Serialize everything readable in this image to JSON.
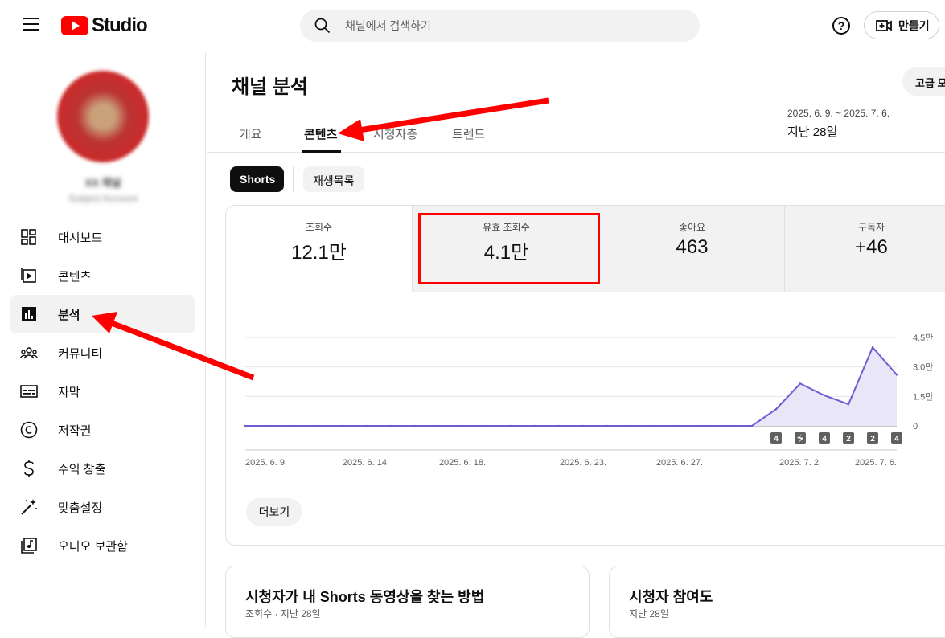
{
  "header": {
    "logo_text": "Studio",
    "search_placeholder": "채널에서 검색하기",
    "create_label": "만들기",
    "help_glyph": "?"
  },
  "sidebar": {
    "channel_name": "XX 채널",
    "channel_sub": "Subject Account",
    "items": [
      {
        "label": "대시보드",
        "icon": "dashboard-icon"
      },
      {
        "label": "콘텐츠",
        "icon": "content-icon"
      },
      {
        "label": "분석",
        "icon": "analytics-icon",
        "active": true
      },
      {
        "label": "커뮤니티",
        "icon": "community-icon"
      },
      {
        "label": "자막",
        "icon": "subtitles-icon"
      },
      {
        "label": "저작권",
        "icon": "copyright-icon"
      },
      {
        "label": "수익 창출",
        "icon": "dollar-icon"
      },
      {
        "label": "맞춤설정",
        "icon": "magic-wand-icon"
      },
      {
        "label": "오디오 보관함",
        "icon": "audio-library-icon"
      }
    ]
  },
  "main": {
    "title": "채널 분석",
    "advanced_label": "고급 모드",
    "tabs": [
      {
        "label": "개요"
      },
      {
        "label": "콘텐츠",
        "active": true
      },
      {
        "label": "시청자층"
      },
      {
        "label": "트렌드"
      }
    ],
    "date_range": "2025. 6. 9. ~ 2025. 7. 6.",
    "date_label": "지난 28일",
    "chips": {
      "shorts": "Shorts",
      "playlist": "재생목록"
    },
    "metrics": [
      {
        "label": "조회수",
        "value": "12.1만"
      },
      {
        "label": "유효 조회수",
        "value": "4.1만"
      },
      {
        "label": "좋아요",
        "value": "463"
      },
      {
        "label": "구독자",
        "value": "+46"
      }
    ],
    "more_label": "더보기",
    "cards": [
      {
        "title": "시청자가 내 Shorts 동영상을 찾는 방법",
        "subtitle": "조회수 · 지난 28일"
      },
      {
        "title": "시청자 참여도",
        "subtitle": "지난 28일"
      }
    ]
  },
  "chart_data": {
    "type": "area",
    "x": [
      "2025. 6. 9.",
      "2025. 6. 10.",
      "2025. 6. 11.",
      "2025. 6. 12.",
      "2025. 6. 13.",
      "2025. 6. 14.",
      "2025. 6. 15.",
      "2025. 6. 16.",
      "2025. 6. 17.",
      "2025. 6. 18.",
      "2025. 6. 19.",
      "2025. 6. 20.",
      "2025. 6. 21.",
      "2025. 6. 22.",
      "2025. 6. 23.",
      "2025. 6. 24.",
      "2025. 6. 25.",
      "2025. 6. 26.",
      "2025. 6. 27.",
      "2025. 6. 28.",
      "2025. 6. 29.",
      "2025. 6. 30.",
      "2025. 7. 1.",
      "2025. 7. 2.",
      "2025. 7. 3.",
      "2025. 7. 4.",
      "2025. 7. 5.",
      "2025. 7. 6."
    ],
    "values": [
      0,
      0,
      0,
      0,
      0,
      0,
      0,
      0,
      0,
      0,
      0,
      0,
      0,
      0,
      0,
      0,
      0,
      0,
      0,
      0,
      0,
      0,
      0.85,
      2.15,
      1.55,
      1.1,
      4.0,
      2.6
    ],
    "x_tick_labels": [
      "2025. 6. 9.",
      "2025. 6. 14.",
      "2025. 6. 18.",
      "2025. 6. 23.",
      "2025. 6. 27.",
      "2025. 7. 2.",
      "2025. 7. 6."
    ],
    "y_tick_labels": [
      "0",
      "1.5만",
      "3.0만",
      "4.5만"
    ],
    "ylim": [
      0,
      4.5
    ],
    "y_unit": "만",
    "line_color": "#6c5dd3",
    "fill_color": "#e9e7f7",
    "markers": [
      {
        "x": "2025. 7. 1.",
        "label": "4"
      },
      {
        "x": "2025. 7. 2.",
        "label": "shorts-icon"
      },
      {
        "x": "2025. 7. 3.",
        "label": "4"
      },
      {
        "x": "2025. 7. 4.",
        "label": "2"
      },
      {
        "x": "2025. 7. 5.",
        "label": "2"
      },
      {
        "x": "2025. 7. 6.",
        "label": "4"
      }
    ]
  },
  "annotations": {
    "arrow_color": "#ff0000",
    "highlight_color": "#ff0000"
  }
}
